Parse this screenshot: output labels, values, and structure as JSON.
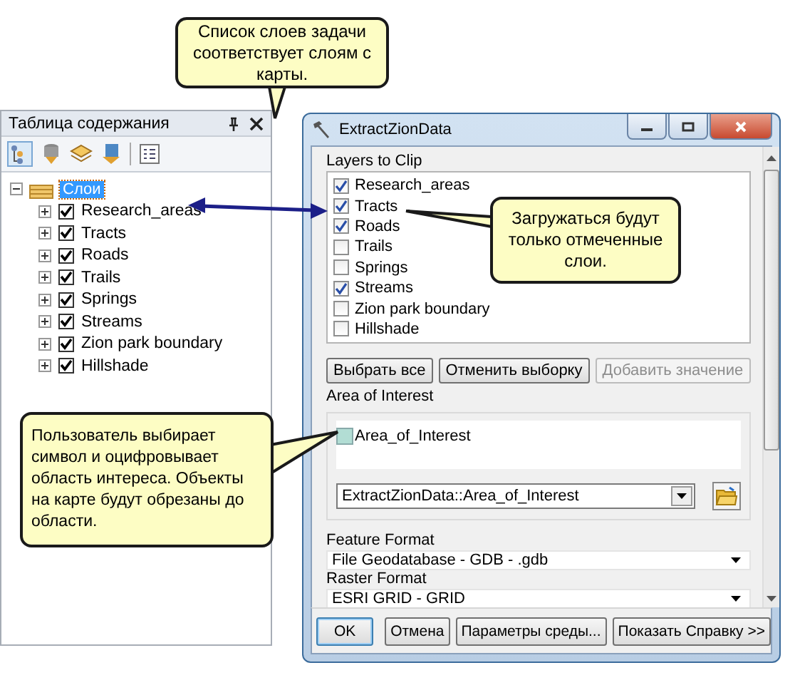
{
  "toc": {
    "title": "Таблица содержания",
    "root": {
      "label": "Слои",
      "expanded": true,
      "selected": true,
      "children": [
        {
          "label": "Research_areas",
          "checked": true,
          "expanded": false
        },
        {
          "label": "Tracts",
          "checked": true,
          "expanded": false
        },
        {
          "label": "Roads",
          "checked": true,
          "expanded": false
        },
        {
          "label": "Trails",
          "checked": true,
          "expanded": false
        },
        {
          "label": "Springs",
          "checked": true,
          "expanded": false
        },
        {
          "label": "Streams",
          "checked": true,
          "expanded": false
        },
        {
          "label": "Zion park boundary",
          "checked": true,
          "expanded": false
        },
        {
          "label": "Hillshade",
          "checked": true,
          "expanded": false
        }
      ]
    }
  },
  "dialog": {
    "title": "ExtractZionData",
    "layers_label": "Layers to Clip",
    "layers": [
      {
        "label": "Research_areas",
        "checked": true
      },
      {
        "label": "Tracts",
        "checked": true
      },
      {
        "label": "Roads",
        "checked": true
      },
      {
        "label": "Trails",
        "checked": false
      },
      {
        "label": "Springs",
        "checked": false
      },
      {
        "label": "Streams",
        "checked": true
      },
      {
        "label": "Zion park boundary",
        "checked": false
      },
      {
        "label": "Hillshade",
        "checked": false
      }
    ],
    "list_buttons": [
      {
        "label": "Выбрать все",
        "disabled": false
      },
      {
        "label": "Отменить выборку",
        "disabled": false
      },
      {
        "label": "Добавить значение",
        "disabled": true
      }
    ],
    "aoi_label": "Area of Interest",
    "aoi_symbol_label": "Area_of_Interest",
    "aoi_value": "ExtractZionData::Area_of_Interest",
    "feature_format_label": "Feature Format",
    "feature_format_value": "File Geodatabase - GDB - .gdb",
    "raster_format_label": "Raster Format",
    "raster_format_value": "ESRI GRID - GRID",
    "footer_buttons": [
      {
        "label": "OK",
        "default": true
      },
      {
        "label": "Отмена",
        "default": false
      },
      {
        "label": "Параметры среды...",
        "default": false
      },
      {
        "label": "Показать Справку >>",
        "default": false
      }
    ]
  },
  "callouts": [
    {
      "text": "Список слоев задачи соответствует слоям с карты."
    },
    {
      "text": "Загружаться будут только отмеченные слои."
    },
    {
      "text": "Пользователь выбирает символ и оцифровывает область интереса. Объекты на карте будут обрезаны до области."
    }
  ]
}
